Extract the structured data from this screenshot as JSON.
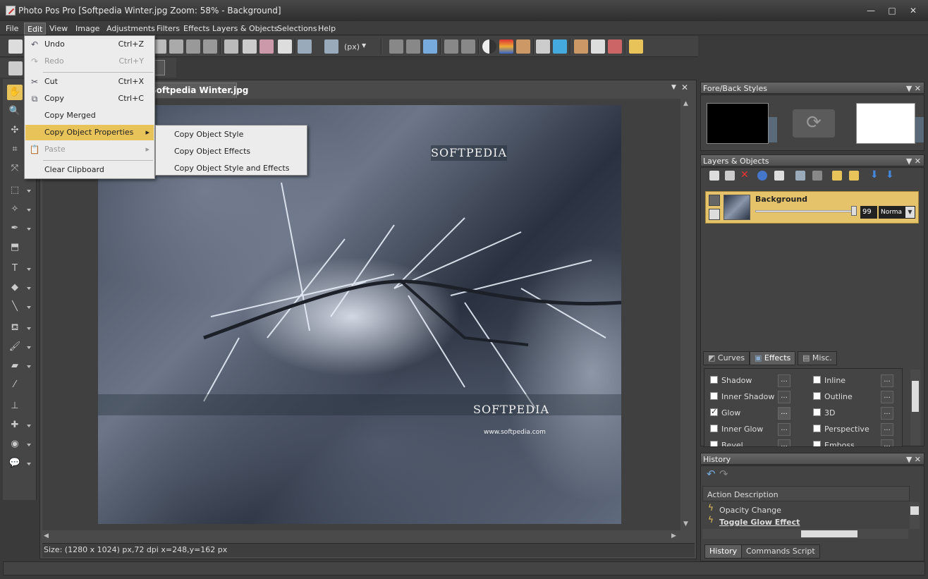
{
  "window": {
    "title": "Photo Pos Pro [Softpedia Winter.jpg Zoom: 58% - Background]",
    "minimize": "—",
    "maximize": "□",
    "close": "✕"
  },
  "menubar": [
    "File",
    "Edit",
    "View",
    "Image",
    "Adjustments",
    "Filters",
    "Effects",
    "Layers & Objects",
    "Selections",
    "Help"
  ],
  "toolbar": {
    "unit_label": "(px)"
  },
  "document": {
    "tab_label": "Softpedia Winter.jpg",
    "status": "Size: (1280 x 1024) px,72 dpi   x=248,y=162 px",
    "watermark_top": "SOFTPEDIA",
    "watermark_mid": "SOFTPEDIA",
    "watermark_url": "www.softpedia.com"
  },
  "edit_menu": {
    "undo": {
      "label": "Undo",
      "shortcut": "Ctrl+Z"
    },
    "redo": {
      "label": "Redo",
      "shortcut": "Ctrl+Y"
    },
    "cut": {
      "label": "Cut",
      "shortcut": "Ctrl+X"
    },
    "copy": {
      "label": "Copy",
      "shortcut": "Ctrl+C"
    },
    "copy_merged": {
      "label": "Copy Merged"
    },
    "copy_object_properties": {
      "label": "Copy Object Properties"
    },
    "paste": {
      "label": "Paste"
    },
    "clear_clipboard": {
      "label": "Clear Clipboard"
    }
  },
  "submenu": [
    "Copy Object Style",
    "Copy Object Effects",
    "Copy Object Style and Effects"
  ],
  "panels": {
    "fore_back": {
      "title": "Fore/Back Styles",
      "fore_color": "#000000",
      "back_color": "#ffffff"
    },
    "layers": {
      "title": "Layers & Objects",
      "layer_name": "Background",
      "opacity": "99",
      "blend_mode": "Norma",
      "tabs": [
        "Curves",
        "Effects",
        "Misc."
      ],
      "effects": [
        {
          "label": "Shadow",
          "checked": false
        },
        {
          "label": "Inline",
          "checked": false
        },
        {
          "label": "Inner Shadow",
          "checked": false
        },
        {
          "label": "Outline",
          "checked": false
        },
        {
          "label": "Glow",
          "checked": true
        },
        {
          "label": "3D",
          "checked": false
        },
        {
          "label": "Inner Glow",
          "checked": false
        },
        {
          "label": "Perspective",
          "checked": false
        },
        {
          "label": "Bevel",
          "checked": false
        },
        {
          "label": "Emboss",
          "checked": false
        }
      ],
      "dots_label": "..."
    },
    "history": {
      "title": "History",
      "column": "Action Description",
      "rows": [
        "Opacity Change",
        "Toggle Glow Effect"
      ],
      "tabs": [
        "History",
        "Commands Script"
      ]
    }
  },
  "colors": {
    "accent": "#e7c35a",
    "dark_bg": "#3a3a3a"
  }
}
